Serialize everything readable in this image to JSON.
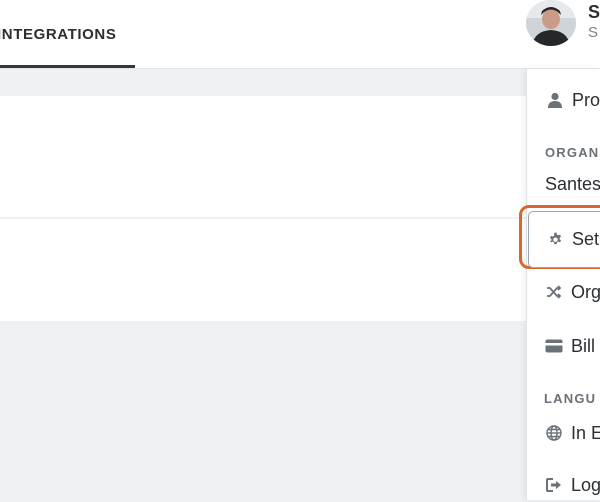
{
  "tabs": [
    {
      "label": "INTEGRATIONS",
      "active": true
    }
  ],
  "user": {
    "name": "S",
    "subtitle": "S",
    "avatar_icon": "user-avatar"
  },
  "menu": {
    "profile_label": "Pro",
    "org_section_header": "ORGAN",
    "org_name": "Santes",
    "settings_label": "Set",
    "organizations_label": "Org",
    "billing_label": "Bill",
    "language_section_header": "LANGU",
    "language_label": "In E",
    "logout_label": "Log"
  },
  "icons": {
    "profile": "user-icon",
    "settings": "gear-icon",
    "organizations": "shuffle-icon",
    "billing": "credit-card-icon",
    "language": "globe-icon",
    "logout": "logout-icon"
  },
  "colors": {
    "highlight": "#d9662a",
    "background": "#eef0f2"
  }
}
